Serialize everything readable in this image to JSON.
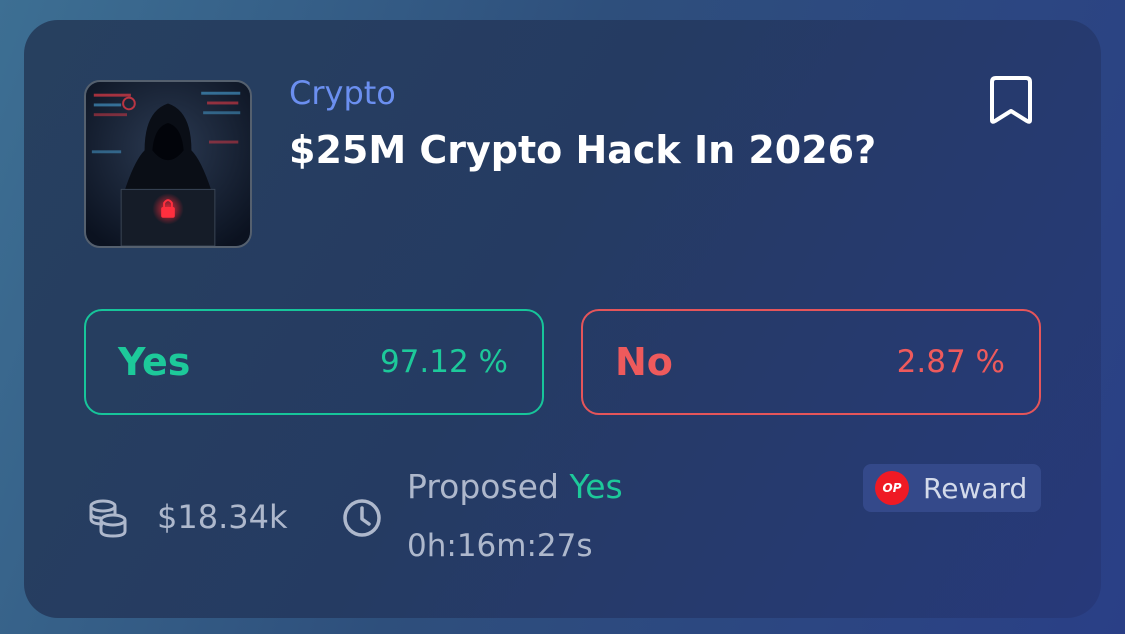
{
  "market": {
    "category": "Crypto",
    "title": "$25M Crypto Hack In 2026?"
  },
  "outcomes": [
    {
      "label": "Yes",
      "percent": "97.12 %",
      "color": "#1dc99a"
    },
    {
      "label": "No",
      "percent": "2.87 %",
      "color": "#ee5a5c"
    }
  ],
  "footer": {
    "volume": "$18.34k",
    "proposed_label": "Proposed",
    "proposed_value": "Yes",
    "timer": "0h:16m:27s",
    "reward_badge": "OP",
    "reward_label": "Reward"
  },
  "icons": {
    "bookmark": "bookmark-icon",
    "volume": "coins-icon",
    "timer": "clock-icon",
    "reward": "optimism-logo-icon"
  },
  "colors": {
    "accent_blue": "#6b8ff0",
    "yes_green": "#1dc99a",
    "no_red": "#ee5a5c",
    "op_red": "#ef1a24"
  }
}
